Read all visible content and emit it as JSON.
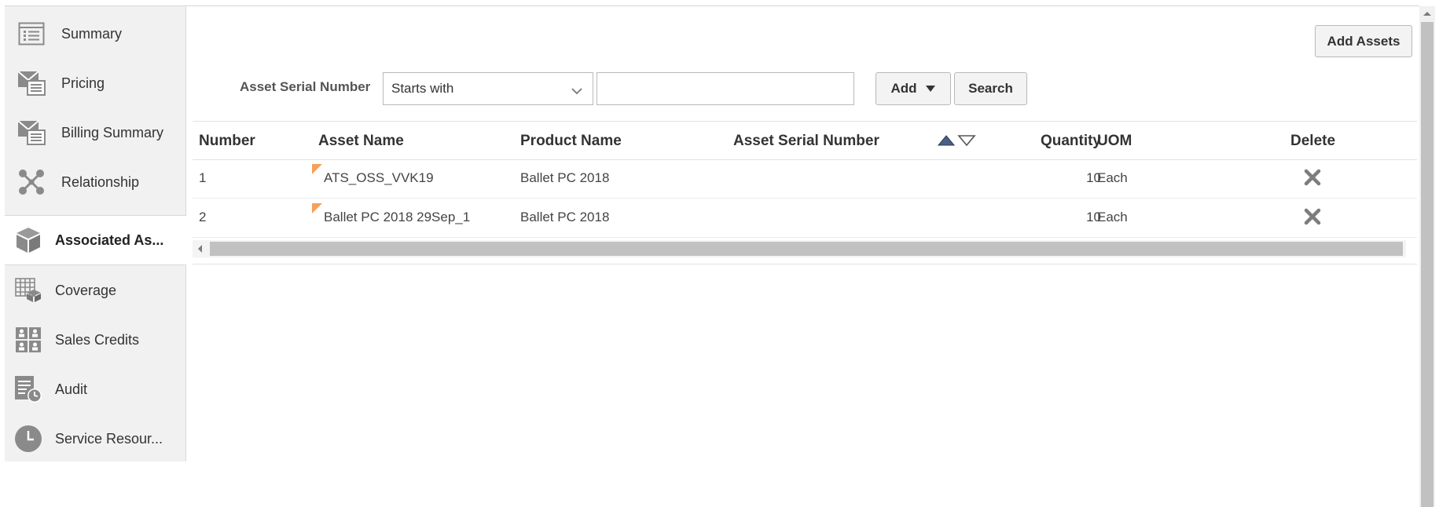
{
  "sidebar": {
    "items": [
      {
        "label": "Summary",
        "icon": "list-icon"
      },
      {
        "label": "Pricing",
        "icon": "envelope-list-icon"
      },
      {
        "label": "Billing Summary",
        "icon": "envelope-list-icon"
      },
      {
        "label": "Relationship",
        "icon": "network-icon"
      },
      {
        "label": "Associated As...",
        "icon": "cube-icon",
        "active": true
      },
      {
        "label": "Coverage",
        "icon": "grid-cube-icon"
      },
      {
        "label": "Sales Credits",
        "icon": "person-grid-icon"
      },
      {
        "label": "Audit",
        "icon": "document-clock-icon"
      },
      {
        "label": "Service Resour...",
        "icon": "clock-icon"
      }
    ]
  },
  "toolbar": {
    "add_assets_label": "Add Assets",
    "search_label": "Asset Serial Number",
    "operator_value": "Starts with",
    "search_value": "",
    "add_label": "Add",
    "search_button_label": "Search"
  },
  "table": {
    "headers": {
      "number": "Number",
      "asset_name": "Asset Name",
      "product_name": "Product Name",
      "serial": "Asset Serial Number",
      "quantity": "Quantity",
      "uom": "UOM",
      "delete": "Delete"
    },
    "rows": [
      {
        "number": "1",
        "asset_name": "ATS_OSS_VVK19",
        "product_name": "Ballet PC 2018",
        "serial": "",
        "quantity": "10",
        "uom": "Each"
      },
      {
        "number": "2",
        "asset_name": "Ballet PC 2018 29Sep_1",
        "product_name": "Ballet PC 2018",
        "serial": "",
        "quantity": "10",
        "uom": "Each"
      }
    ]
  },
  "colors": {
    "sidebar_bg": "#f1f1f1",
    "flag": "#f6a05c",
    "icon_gray": "#8a8a8a",
    "sort_up": "#4b5e86"
  }
}
